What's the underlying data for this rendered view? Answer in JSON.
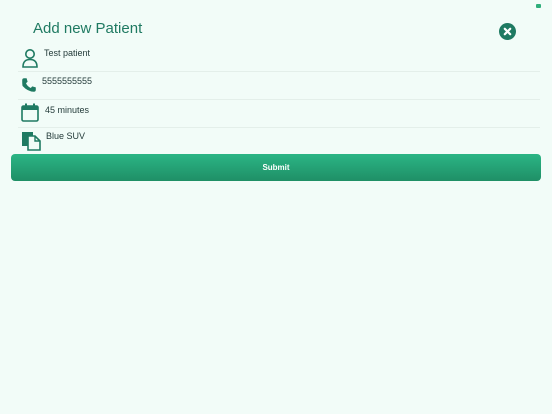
{
  "header": {
    "title": "Add new Patient",
    "close_icon": "close-icon"
  },
  "form": {
    "fields": [
      {
        "name": "patient-name",
        "icon": "person-icon",
        "value": "Test patient"
      },
      {
        "name": "phone",
        "icon": "phone-icon",
        "value": "5555555555"
      },
      {
        "name": "wait-time",
        "icon": "calendar-icon",
        "value": "45 minutes"
      },
      {
        "name": "vehicle",
        "icon": "documents-icon",
        "value": "Blue SUV"
      }
    ]
  },
  "actions": {
    "submit_label": "Submit"
  },
  "colors": {
    "accent": "#1f7a62",
    "button": "#26a87a",
    "background": "#f2fcf8"
  }
}
